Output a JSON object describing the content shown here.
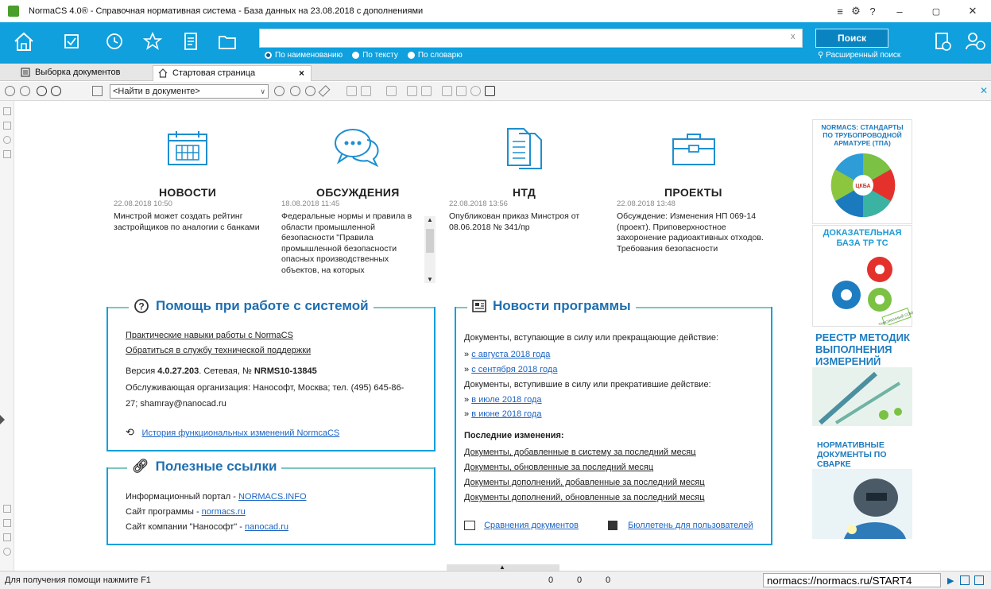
{
  "window": {
    "title": "NormaCS 4.0® - Справочная нормативная система - База данных на 23.08.2018 с дополнениями",
    "controls": {
      "menu": "≡",
      "settings": "⚙",
      "help": "?",
      "minimize": "–",
      "restore": "▢",
      "close": "✕"
    }
  },
  "toolbar": {
    "icons": [
      "home-icon",
      "checklist-icon",
      "history-icon",
      "star-icon",
      "document-icon",
      "folder-icon"
    ],
    "search": {
      "value": "",
      "clear": "x",
      "button": "Поиск",
      "advanced": "Расширенный поиск",
      "modes": [
        {
          "label": "По наименованию",
          "selected": true
        },
        {
          "label": "По тексту",
          "selected": false
        },
        {
          "label": "По словарю",
          "selected": false
        }
      ]
    }
  },
  "tabs": [
    {
      "label": "Выборка документов",
      "active": false
    },
    {
      "label": "Стартовая страница",
      "active": true,
      "close": "×"
    }
  ],
  "doctools": {
    "find_value": "<Найти в документе>"
  },
  "cards": [
    {
      "title": "НОВОСТИ",
      "date": "22.08.2018 10:50",
      "text": "Минстрой может создать рейтинг застройщиков по аналогии с банками"
    },
    {
      "title": "ОБСУЖДЕНИЯ",
      "date": "18.08.2018 11:45",
      "text": "Федеральные нормы и правила в области промышленной безопасности \"Правила промышленной безопасности опасных производственных объектов, на которых"
    },
    {
      "title": "НТД",
      "date": "22.08.2018 13:56",
      "text": "Опубликован приказ Минстроя от 08.06.2018 № 341/пр"
    },
    {
      "title": "ПРОЕКТЫ",
      "date": "22.08.2018 13:48",
      "text": "Обсуждение: Изменения НП 069-14 (проект). Приповерхностное захоронение радиоактивных отходов. Требования безопасности"
    }
  ],
  "help": {
    "heading": "Помощь при работе с системой",
    "links": [
      "Практические навыки работы с NormaCS",
      "Обратиться в службу технической поддержки"
    ],
    "version_prefix": "Версия ",
    "version": "4.0.27.203",
    "version_mid": ". Сетевая, № ",
    "serial": "NRMS10-13845",
    "org_line1": "Обслуживающая организация: Нанософт, Москва; тел. (495) 645-86-",
    "org_line2": "27; shamray@nanocad.ru",
    "history_link": "История функциональных изменений NormcaCS"
  },
  "useful": {
    "heading": "Полезные ссылки",
    "rows": [
      {
        "label": "Информационный портал - ",
        "link": "NORMACS.INFO"
      },
      {
        "label": "Сайт программы - ",
        "link": "normacs.ru"
      },
      {
        "label": "Сайт компании \"Нанософт\" - ",
        "link": "nanocad.ru"
      }
    ]
  },
  "news": {
    "heading": "Новости программы",
    "intro1": "Документы, вступающие в силу или прекращающие действие:",
    "links1": [
      "с августа 2018 года",
      "с сентября 2018 года"
    ],
    "intro2": "Документы, вступившие в силу или прекратившие действие:",
    "links2": [
      "в июле 2018 года",
      "в июне 2018 года"
    ],
    "bullet": "»",
    "recent_heading": "Последние изменения:",
    "recent": [
      "Документы, добавленные в систему за последний месяц",
      "Документы, обновленные за последний месяц",
      "Документы дополнений, добавленные за последний месяц",
      "Документы дополнений, обновленные за последний месяц"
    ],
    "compare_link": "Сравнения документов",
    "bulletin_link": "Бюллетень для пользователей"
  },
  "ads": [
    {
      "title": "NORMACS: СТАНДАРТЫ ПО ТРУБОПРОВОДНОЙ АРМАТУРЕ (ТПА)",
      "center": "ЦКБА"
    },
    {
      "title": "ДОКАЗАТЕЛЬНАЯ БАЗА ТР ТС",
      "badge": "ТАМОЖЕННЫЙ СОЮЗ"
    },
    {
      "title": "РЕЕСТР МЕТОДИК ВЫПОЛНЕНИЯ ИЗМЕРЕНИЙ"
    },
    {
      "title": "НОРМАТИВНЫЕ ДОКУМЕНТЫ ПО СВАРКЕ"
    }
  ],
  "status": {
    "help": "Для получения помощи нажмите F1",
    "counters": [
      "0",
      "0",
      "0"
    ],
    "url": "normacs://normacs.ru/START4",
    "splitter": "▲"
  },
  "colors": {
    "accent": "#0fa0dd",
    "link": "#1c64c2",
    "heading": "#1f6fb0"
  }
}
